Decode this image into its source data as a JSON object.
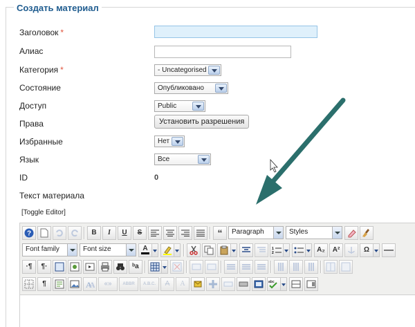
{
  "form": {
    "legend": "Создать материал",
    "fields": {
      "title": {
        "label": "Заголовок",
        "required_mark": "*",
        "value": ""
      },
      "alias": {
        "label": "Алиас",
        "value": ""
      },
      "category": {
        "label": "Категория",
        "required_mark": "*",
        "value": "- Uncategorised"
      },
      "state": {
        "label": "Состояние",
        "value": "Опубликовано"
      },
      "access": {
        "label": "Доступ",
        "value": "Public"
      },
      "permissions": {
        "label": "Права",
        "button_label": "Установить разрешения"
      },
      "featured": {
        "label": "Избранные",
        "value": "Нет"
      },
      "language": {
        "label": "Язык",
        "value": "Все"
      },
      "id": {
        "label": "ID",
        "value": "0"
      },
      "article_text": {
        "label": "Текст материала"
      }
    }
  },
  "editor": {
    "toggle_label": "[Toggle Editor]",
    "format_select": "Paragraph",
    "styles_select": "Styles",
    "font_family_select": "Font family",
    "font_size_select": "Font size",
    "content": ""
  },
  "toolbar": {
    "bold": "B",
    "italic": "I",
    "underline": "U",
    "strike": "S",
    "blockquote": "“",
    "text_color": "A",
    "omega": "Ω",
    "ltr": "·¶",
    "rtl": "¶·",
    "subscript": "A₂",
    "superscript": "A²",
    "cite": "«»",
    "abbr": "ABBR",
    "acronym": "A.B.C.",
    "ins": "A",
    "del": "A",
    "nbsp": "¶",
    "spellcheck": "abc",
    "styleprops": "ᵇa",
    "pilcrow": "¶"
  },
  "colors": {
    "legend": "#1f5c8f",
    "required": "#e0543d",
    "annotation_arrow": "#2b6f6c"
  },
  "icons": [
    "help-icon",
    "new-document-icon",
    "undo-icon",
    "redo-icon",
    "align-left-icon",
    "align-center-icon",
    "align-right-icon",
    "align-justify-icon",
    "eraser-icon",
    "cleanup-icon",
    "text-color-icon",
    "highlight-icon",
    "cut-icon",
    "copy-icon",
    "paste-icon",
    "search-icon",
    "replace-icon",
    "print-icon",
    "fullscreen-icon",
    "image-icon",
    "table-icon",
    "anchor-icon",
    "link-icon",
    "horizontal-rule-icon",
    "annotation-arrow-icon",
    "mouse-cursor-icon"
  ]
}
